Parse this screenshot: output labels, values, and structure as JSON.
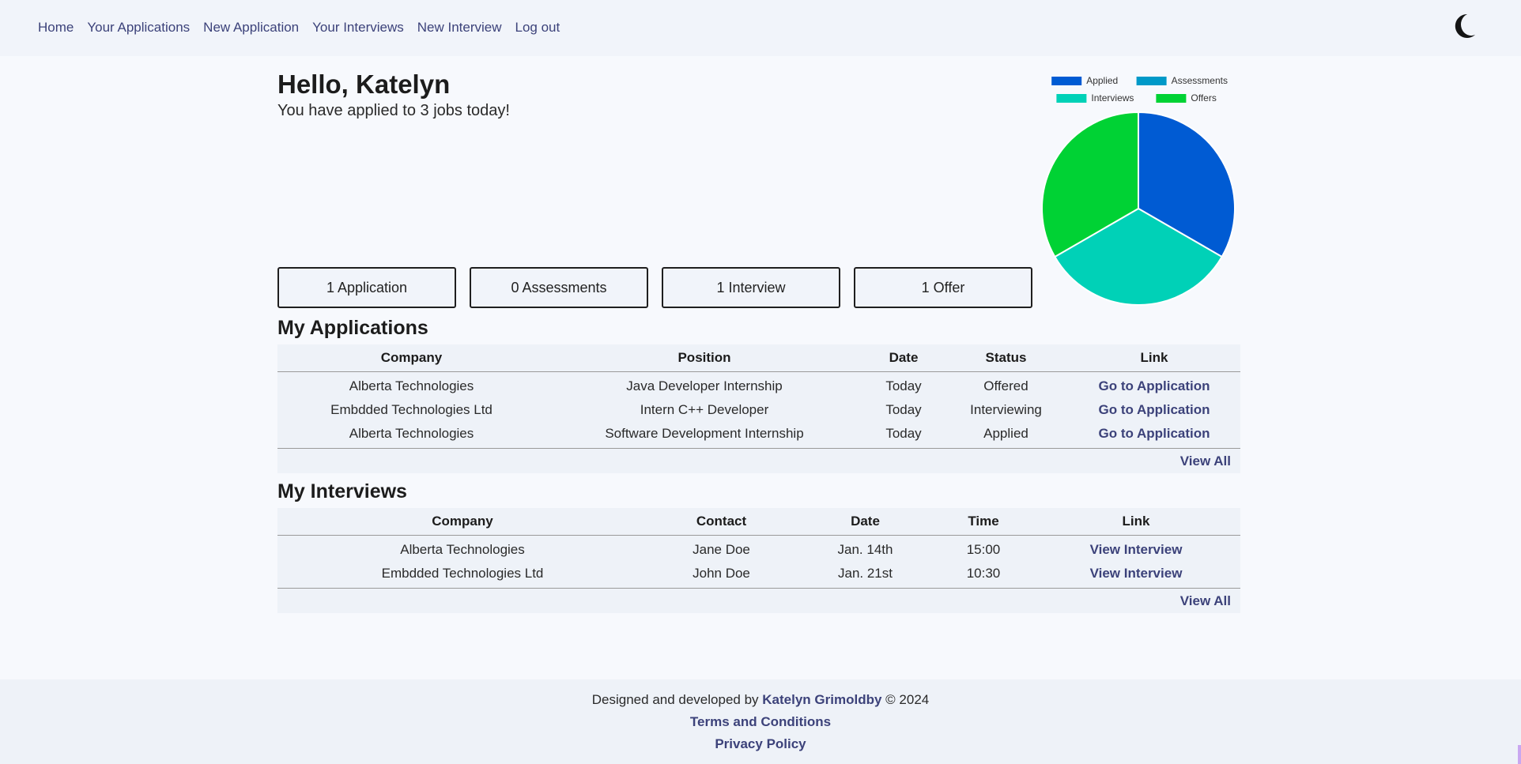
{
  "nav": {
    "links": [
      "Home",
      "Your Applications",
      "New Application",
      "Your Interviews",
      "New Interview",
      "Log out"
    ],
    "theme_toggle_icon": "moon-icon"
  },
  "greeting": {
    "title": "Hello, Katelyn",
    "subtitle": "You have applied to 3 jobs today!"
  },
  "summary": {
    "applications": "1 Application",
    "assessments": "0 Assessments",
    "interviews": "1 Interview",
    "offers": "1 Offer"
  },
  "chart_data": {
    "type": "pie",
    "categories": [
      "Applied",
      "Assessments",
      "Interviews",
      "Offers"
    ],
    "values": [
      1,
      0,
      1,
      1
    ],
    "colors": [
      "#005bd3",
      "#0099c8",
      "#00d1b7",
      "#00d234"
    ],
    "legend": "top"
  },
  "applications": {
    "title": "My Applications",
    "columns": [
      "Company",
      "Position",
      "Date",
      "Status",
      "Link"
    ],
    "rows": [
      {
        "company": "Alberta Technologies",
        "position": "Java Developer Internship",
        "date": "Today",
        "status": "Offered",
        "link": "Go to Application"
      },
      {
        "company": "Embdded Technologies Ltd",
        "position": "Intern C++ Developer",
        "date": "Today",
        "status": "Interviewing",
        "link": "Go to Application"
      },
      {
        "company": "Alberta Technologies",
        "position": "Software Development Internship",
        "date": "Today",
        "status": "Applied",
        "link": "Go to Application"
      }
    ],
    "view_all": "View All"
  },
  "interviews": {
    "title": "My Interviews",
    "columns": [
      "Company",
      "Contact",
      "Date",
      "Time",
      "Link"
    ],
    "rows": [
      {
        "company": "Alberta Technologies",
        "contact": "Jane Doe",
        "date": "Jan. 14th",
        "time": "15:00",
        "link": "View Interview"
      },
      {
        "company": "Embdded Technologies Ltd",
        "contact": "John Doe",
        "date": "Jan. 21st",
        "time": "10:30",
        "link": "View Interview"
      }
    ],
    "view_all": "View All"
  },
  "footer": {
    "designed_prefix": "Designed and developed by",
    "author": "Katelyn Grimoldby",
    "copyright": "© 2024",
    "terms": "Terms and Conditions",
    "privacy": "Privacy Policy"
  }
}
